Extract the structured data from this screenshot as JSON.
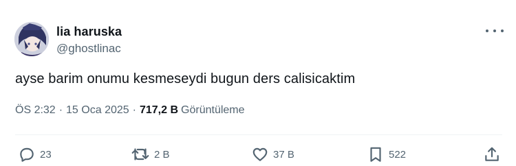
{
  "user": {
    "display_name": "lia haruska",
    "handle": "@ghostlinac"
  },
  "tweet": {
    "text": "ayse barim onumu kesmeseydi bugun ders calisicaktim",
    "time": "ÖS 2:32",
    "date": "15 Oca 2025",
    "views_count": "717,2 B",
    "views_label": "Görüntüleme",
    "separator": "·"
  },
  "actions": {
    "replies": "23",
    "retweets": "2 B",
    "likes": "37 B",
    "bookmarks": "522"
  },
  "colors": {
    "text_primary": "#0f1419",
    "text_secondary": "#536471",
    "divider": "#eff3f4"
  },
  "icons": [
    "more-icon",
    "reply-icon",
    "retweet-icon",
    "like-icon",
    "bookmark-icon",
    "share-icon"
  ]
}
